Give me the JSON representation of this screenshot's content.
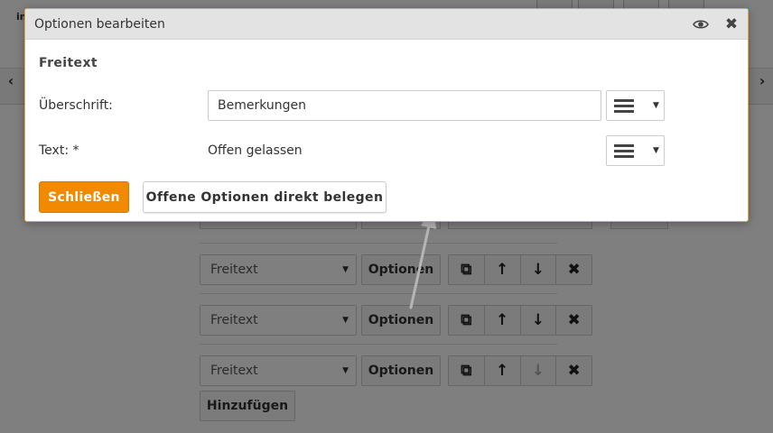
{
  "background": {
    "rows": [
      {
        "select_value": "Freitext",
        "options_label": "Optionen",
        "down_disabled": false
      },
      {
        "select_value": "Freitext",
        "options_label": "Optionen",
        "down_disabled": false
      },
      {
        "select_value": "Freitext",
        "options_label": "Optionen",
        "down_disabled": true
      }
    ],
    "icons": {
      "copy": "⧉",
      "up": "↑",
      "down": "↓",
      "delete": "✖"
    },
    "add_label": "Hinzufügen",
    "nav_left": "‹",
    "nav_right": "›",
    "brand_partial": "in"
  },
  "modal": {
    "title": "Optionen bearbeiten",
    "section_title": "Freitext",
    "fields": {
      "heading_label": "Überschrift:",
      "heading_value": "Bemerkungen",
      "text_label": "Text: *",
      "text_value": "Offen gelassen"
    },
    "buttons": {
      "close_label": "Schließen",
      "assign_label": "Offene Optionen direkt belegen"
    },
    "icons": {
      "close": "✖"
    }
  },
  "colors": {
    "accent": "#f18a00",
    "modal_border": "#f0a23c",
    "header_bg": "#e3e3e3",
    "overlay": "rgba(0,0,0,0.5)"
  }
}
